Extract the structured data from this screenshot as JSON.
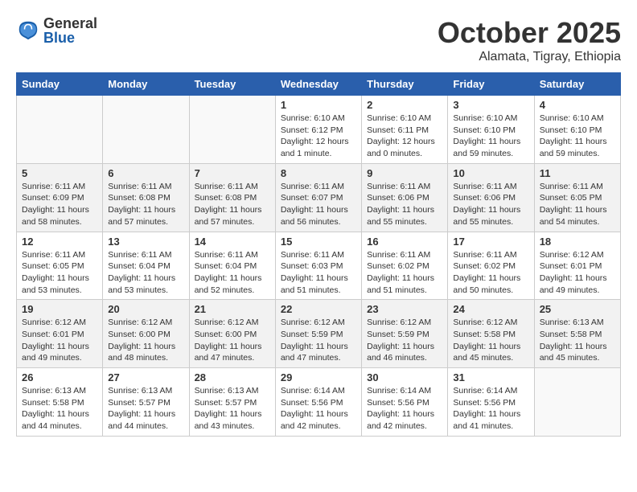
{
  "header": {
    "logo": {
      "general": "General",
      "blue": "Blue"
    },
    "title": "October 2025",
    "location": "Alamata, Tigray, Ethiopia"
  },
  "days_of_week": [
    "Sunday",
    "Monday",
    "Tuesday",
    "Wednesday",
    "Thursday",
    "Friday",
    "Saturday"
  ],
  "weeks": [
    [
      {
        "day": "",
        "info": ""
      },
      {
        "day": "",
        "info": ""
      },
      {
        "day": "",
        "info": ""
      },
      {
        "day": "1",
        "info": "Sunrise: 6:10 AM\nSunset: 6:12 PM\nDaylight: 12 hours\nand 1 minute."
      },
      {
        "day": "2",
        "info": "Sunrise: 6:10 AM\nSunset: 6:11 PM\nDaylight: 12 hours\nand 0 minutes."
      },
      {
        "day": "3",
        "info": "Sunrise: 6:10 AM\nSunset: 6:10 PM\nDaylight: 11 hours\nand 59 minutes."
      },
      {
        "day": "4",
        "info": "Sunrise: 6:10 AM\nSunset: 6:10 PM\nDaylight: 11 hours\nand 59 minutes."
      }
    ],
    [
      {
        "day": "5",
        "info": "Sunrise: 6:11 AM\nSunset: 6:09 PM\nDaylight: 11 hours\nand 58 minutes."
      },
      {
        "day": "6",
        "info": "Sunrise: 6:11 AM\nSunset: 6:08 PM\nDaylight: 11 hours\nand 57 minutes."
      },
      {
        "day": "7",
        "info": "Sunrise: 6:11 AM\nSunset: 6:08 PM\nDaylight: 11 hours\nand 57 minutes."
      },
      {
        "day": "8",
        "info": "Sunrise: 6:11 AM\nSunset: 6:07 PM\nDaylight: 11 hours\nand 56 minutes."
      },
      {
        "day": "9",
        "info": "Sunrise: 6:11 AM\nSunset: 6:06 PM\nDaylight: 11 hours\nand 55 minutes."
      },
      {
        "day": "10",
        "info": "Sunrise: 6:11 AM\nSunset: 6:06 PM\nDaylight: 11 hours\nand 55 minutes."
      },
      {
        "day": "11",
        "info": "Sunrise: 6:11 AM\nSunset: 6:05 PM\nDaylight: 11 hours\nand 54 minutes."
      }
    ],
    [
      {
        "day": "12",
        "info": "Sunrise: 6:11 AM\nSunset: 6:05 PM\nDaylight: 11 hours\nand 53 minutes."
      },
      {
        "day": "13",
        "info": "Sunrise: 6:11 AM\nSunset: 6:04 PM\nDaylight: 11 hours\nand 53 minutes."
      },
      {
        "day": "14",
        "info": "Sunrise: 6:11 AM\nSunset: 6:04 PM\nDaylight: 11 hours\nand 52 minutes."
      },
      {
        "day": "15",
        "info": "Sunrise: 6:11 AM\nSunset: 6:03 PM\nDaylight: 11 hours\nand 51 minutes."
      },
      {
        "day": "16",
        "info": "Sunrise: 6:11 AM\nSunset: 6:02 PM\nDaylight: 11 hours\nand 51 minutes."
      },
      {
        "day": "17",
        "info": "Sunrise: 6:11 AM\nSunset: 6:02 PM\nDaylight: 11 hours\nand 50 minutes."
      },
      {
        "day": "18",
        "info": "Sunrise: 6:12 AM\nSunset: 6:01 PM\nDaylight: 11 hours\nand 49 minutes."
      }
    ],
    [
      {
        "day": "19",
        "info": "Sunrise: 6:12 AM\nSunset: 6:01 PM\nDaylight: 11 hours\nand 49 minutes."
      },
      {
        "day": "20",
        "info": "Sunrise: 6:12 AM\nSunset: 6:00 PM\nDaylight: 11 hours\nand 48 minutes."
      },
      {
        "day": "21",
        "info": "Sunrise: 6:12 AM\nSunset: 6:00 PM\nDaylight: 11 hours\nand 47 minutes."
      },
      {
        "day": "22",
        "info": "Sunrise: 6:12 AM\nSunset: 5:59 PM\nDaylight: 11 hours\nand 47 minutes."
      },
      {
        "day": "23",
        "info": "Sunrise: 6:12 AM\nSunset: 5:59 PM\nDaylight: 11 hours\nand 46 minutes."
      },
      {
        "day": "24",
        "info": "Sunrise: 6:12 AM\nSunset: 5:58 PM\nDaylight: 11 hours\nand 45 minutes."
      },
      {
        "day": "25",
        "info": "Sunrise: 6:13 AM\nSunset: 5:58 PM\nDaylight: 11 hours\nand 45 minutes."
      }
    ],
    [
      {
        "day": "26",
        "info": "Sunrise: 6:13 AM\nSunset: 5:58 PM\nDaylight: 11 hours\nand 44 minutes."
      },
      {
        "day": "27",
        "info": "Sunrise: 6:13 AM\nSunset: 5:57 PM\nDaylight: 11 hours\nand 44 minutes."
      },
      {
        "day": "28",
        "info": "Sunrise: 6:13 AM\nSunset: 5:57 PM\nDaylight: 11 hours\nand 43 minutes."
      },
      {
        "day": "29",
        "info": "Sunrise: 6:14 AM\nSunset: 5:56 PM\nDaylight: 11 hours\nand 42 minutes."
      },
      {
        "day": "30",
        "info": "Sunrise: 6:14 AM\nSunset: 5:56 PM\nDaylight: 11 hours\nand 42 minutes."
      },
      {
        "day": "31",
        "info": "Sunrise: 6:14 AM\nSunset: 5:56 PM\nDaylight: 11 hours\nand 41 minutes."
      },
      {
        "day": "",
        "info": ""
      }
    ]
  ]
}
